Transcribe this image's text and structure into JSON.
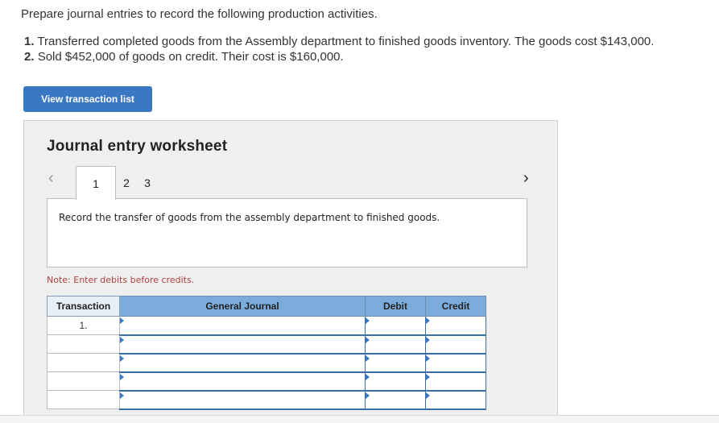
{
  "instructions": {
    "intro": "Prepare journal entries to record the following production activities.",
    "items": [
      {
        "num": "1.",
        "text": "Transferred completed goods from the Assembly department to finished goods inventory. The goods cost $143,000."
      },
      {
        "num": "2.",
        "text": "Sold $452,000 of goods on credit. Their cost is $160,000."
      }
    ]
  },
  "view_transaction_button": "View transaction list",
  "worksheet": {
    "title": "Journal entry worksheet",
    "prev_icon": "chevron-left",
    "next_icon": "chevron-right",
    "tabs": [
      "1",
      "2",
      "3"
    ],
    "active_tab": "1",
    "description": "Record the transfer of goods from the assembly department to finished goods.",
    "note": "Note: Enter debits before credits."
  },
  "journal": {
    "headers": {
      "transaction": "Transaction",
      "general_journal": "General Journal",
      "debit": "Debit",
      "credit": "Credit"
    },
    "rows": [
      {
        "transaction": "1.",
        "account": "",
        "debit": "",
        "credit": ""
      },
      {
        "transaction": "",
        "account": "",
        "debit": "",
        "credit": ""
      },
      {
        "transaction": "",
        "account": "",
        "debit": "",
        "credit": ""
      },
      {
        "transaction": "",
        "account": "",
        "debit": "",
        "credit": ""
      },
      {
        "transaction": "",
        "account": "",
        "debit": "",
        "credit": ""
      }
    ]
  }
}
